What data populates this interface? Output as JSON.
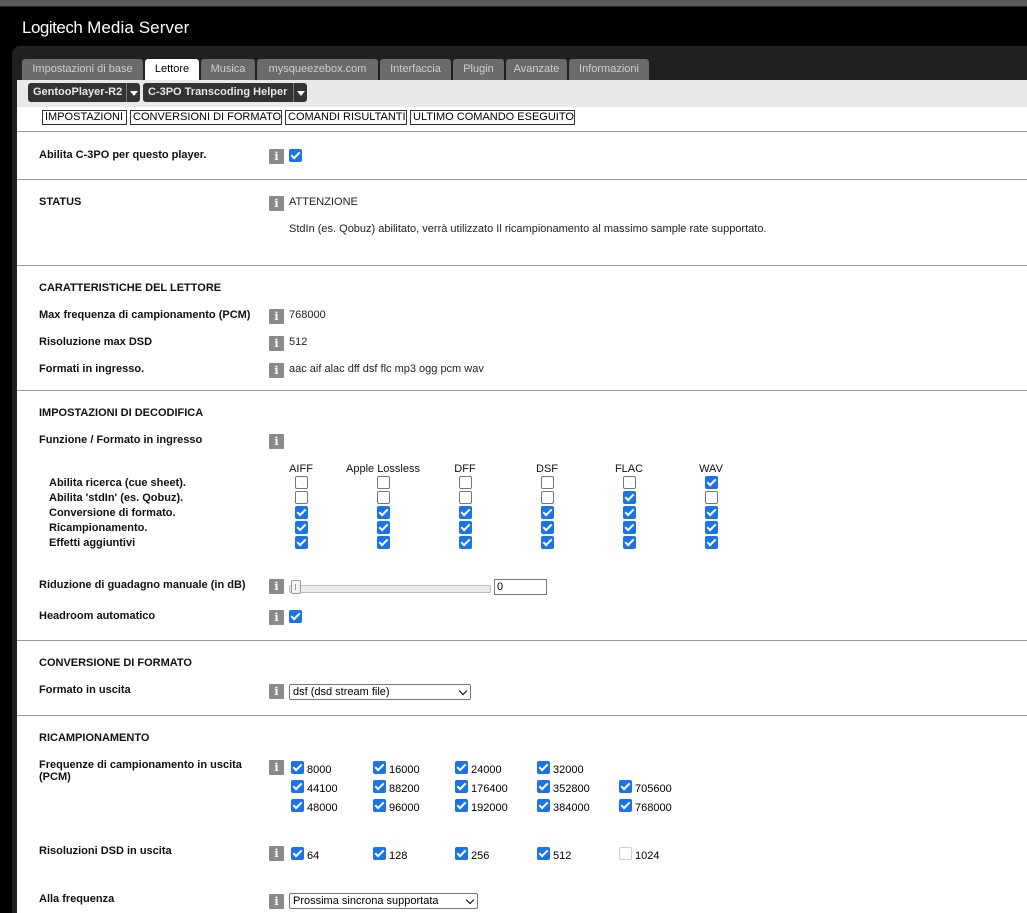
{
  "app": {
    "brand_logo": "Logitech",
    "brand_suffix": "Media Server"
  },
  "tabs": [
    "Impostazioni di base",
    "Lettore",
    "Musica",
    "mysqueezebox.com",
    "Interfaccia",
    "Plugin",
    "Avanzate",
    "Informazioni"
  ],
  "active_tab": "Lettore",
  "player_select": "GentooPlayer-R2",
  "plugin_select": "C-3PO Transcoding Helper",
  "subtabs": [
    "IMPOSTAZIONI",
    "CONVERSIONI DI FORMATO",
    "COMANDI RISULTANTI",
    "ULTIMO COMANDO ESEGUITO"
  ],
  "enable": {
    "label": "Abilita C-3PO per questo player.",
    "checked": true
  },
  "status": {
    "title": "STATUS",
    "heading": "ATTENZIONE",
    "message": "StdIn (es. Qobuz) abilitato, verrà utilizzato Il ricampionamento al massimo sample rate supportato."
  },
  "player_caps": {
    "title": "CARATTERISTICHE DEL LETTORE",
    "max_pcm_label": "Max frequenza di campionamento (PCM)",
    "max_pcm": "768000",
    "max_dsd_label": "Risoluzione max DSD",
    "max_dsd": "512",
    "formats_label": "Formati in ingresso.",
    "formats": "aac aif alac dff dsf flc mp3 ogg pcm wav"
  },
  "decode": {
    "title": "IMPOSTAZIONI DI DECODIFICA",
    "label": "Funzione / Formato in ingresso",
    "columns": [
      "AIFF",
      "Apple Lossless",
      "DFF",
      "DSF",
      "FLAC",
      "WAV"
    ],
    "rows": [
      {
        "label": "Abilita ricerca (cue sheet).",
        "values": [
          false,
          false,
          false,
          false,
          false,
          true
        ]
      },
      {
        "label": "Abilita 'stdIn' (es. Qobuz).",
        "values": [
          false,
          false,
          false,
          false,
          true,
          false
        ]
      },
      {
        "label": "Conversione di formato.",
        "values": [
          true,
          true,
          true,
          true,
          true,
          true
        ]
      },
      {
        "label": "Ricampionamento.",
        "values": [
          true,
          true,
          true,
          true,
          true,
          true
        ]
      },
      {
        "label": "Effetti aggiuntivi",
        "values": [
          true,
          true,
          true,
          true,
          true,
          true
        ]
      }
    ],
    "gain_label": "Riduzione di guadagno manuale (in dB)",
    "gain_value": "0",
    "headroom_label": "Headroom automatico",
    "headroom": true
  },
  "conversion": {
    "title": "CONVERSIONE DI FORMATO",
    "label": "Formato in uscita",
    "value": "dsf (dsd stream file)"
  },
  "resampling": {
    "title": "RICAMPIONAMENTO",
    "pcm_label_1": "Frequenze di campionamento in uscita",
    "pcm_label_2": "(PCM)",
    "pcm_rates": [
      [
        {
          "v": "8000",
          "c": true
        },
        {
          "v": "16000",
          "c": true
        },
        {
          "v": "24000",
          "c": true
        },
        {
          "v": "32000",
          "c": true
        }
      ],
      [
        {
          "v": "44100",
          "c": true
        },
        {
          "v": "88200",
          "c": true
        },
        {
          "v": "176400",
          "c": true
        },
        {
          "v": "352800",
          "c": true
        },
        {
          "v": "705600",
          "c": true
        }
      ],
      [
        {
          "v": "48000",
          "c": true
        },
        {
          "v": "96000",
          "c": true
        },
        {
          "v": "192000",
          "c": true
        },
        {
          "v": "384000",
          "c": true
        },
        {
          "v": "768000",
          "c": true
        }
      ]
    ],
    "dsd_label": "Risoluzioni DSD in uscita",
    "dsd_rates": [
      {
        "v": "64",
        "c": true
      },
      {
        "v": "128",
        "c": true
      },
      {
        "v": "256",
        "c": true
      },
      {
        "v": "512",
        "c": true
      },
      {
        "v": "1024",
        "c": false,
        "disabled": true
      }
    ],
    "freq_label": "Alla frequenza",
    "freq_value": "Prossima sincrona supportata"
  }
}
